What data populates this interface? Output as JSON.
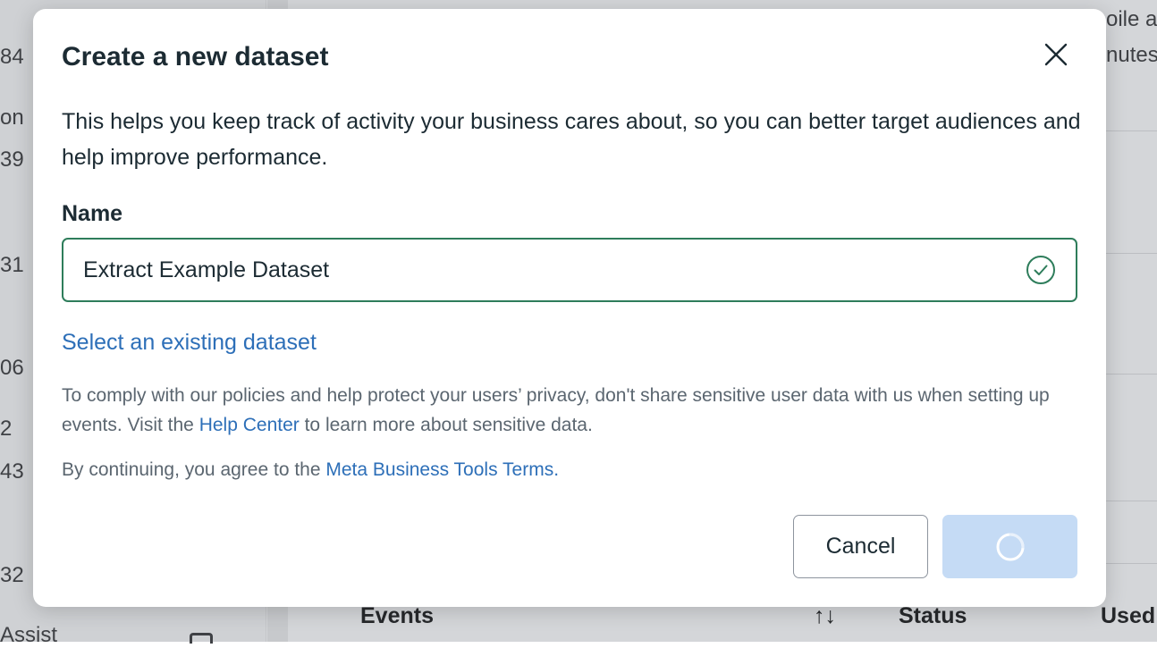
{
  "background": {
    "left_fragments": [
      "84",
      "on",
      "39",
      "31",
      "06",
      "2",
      "43",
      "32",
      "Assist"
    ],
    "right_fragments": [
      "oile a",
      "nutes"
    ],
    "table_headers": {
      "events": "Events",
      "sort_icon": "↑↓",
      "status": "Status",
      "used": "Used"
    }
  },
  "modal": {
    "title": "Create a new dataset",
    "close_icon": "close-icon",
    "description": "This helps you keep track of activity your business cares about, so you can better target audiences and help improve performance.",
    "name_label": "Name",
    "name_value": "Extract Example Dataset",
    "valid_icon": "check-circle-icon",
    "select_existing_link": "Select an existing dataset",
    "notice": {
      "before_link": "To comply with our policies and help protect your users’ privacy, don't share sensitive user data with us when setting up events. Visit the ",
      "link": "Help Center",
      "after_link": " to learn more about sensitive data."
    },
    "terms": {
      "before_link": "By continuing, you agree to the ",
      "link": "Meta Business Tools Terms."
    },
    "cancel_label": "Cancel",
    "create_state": "loading"
  },
  "colors": {
    "accent_link": "#2d6fb8",
    "input_valid_border": "#2e7d5b",
    "primary_button_disabled": "#c5dbf5"
  }
}
